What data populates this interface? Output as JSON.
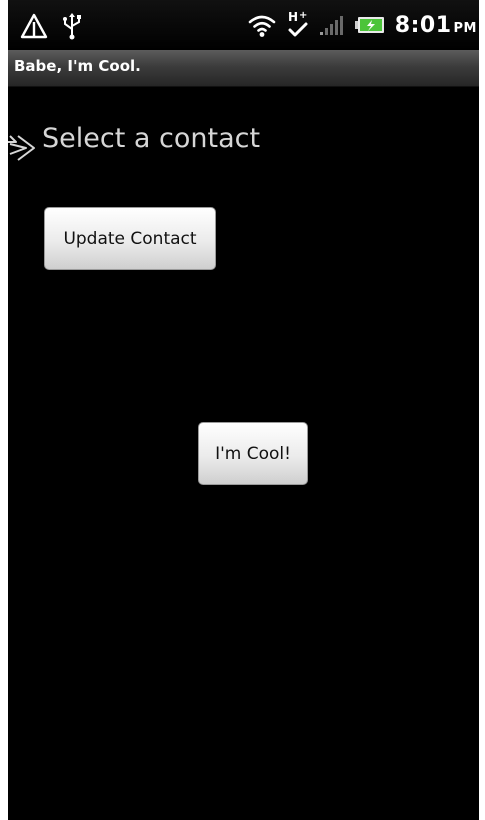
{
  "status_bar": {
    "time": "8:01",
    "ampm": "PM",
    "icons": [
      "warning-icon",
      "usb-icon",
      "wifi-icon",
      "hspa-plus-icon",
      "signal-icon",
      "battery-charging-icon"
    ]
  },
  "title_bar": {
    "title": "Babe, I'm Cool."
  },
  "main": {
    "select_contact_label": "Select a contact",
    "update_contact_button": "Update Contact",
    "im_cool_button": "I'm Cool!"
  },
  "colors": {
    "background": "#000000",
    "label_text": "#d6d6d6",
    "battery": "#4cc43a"
  }
}
